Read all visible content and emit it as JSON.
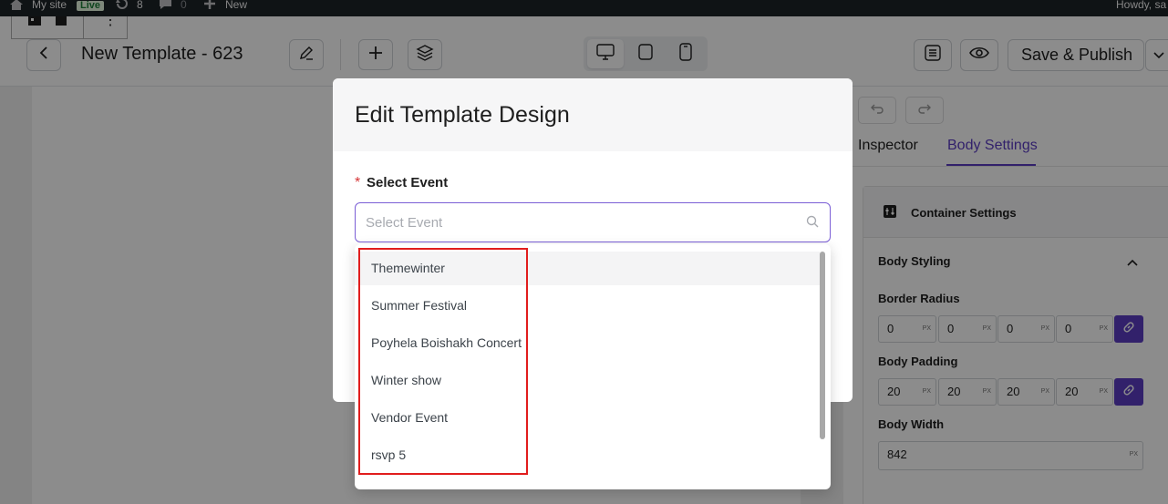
{
  "adminbar": {
    "site_name": "My site",
    "live_badge": "Live",
    "updates_count": "8",
    "comments_count": "0",
    "new_label": "New",
    "greeting": "Howdy, sa"
  },
  "toolbar": {
    "title": "New Template - 623",
    "publish_label": "Save & Publish"
  },
  "panel": {
    "tabs": [
      {
        "label": "Inspector",
        "active": false
      },
      {
        "label": "Body Settings",
        "active": true
      }
    ],
    "section_title": "Container Settings",
    "group_title": "Body Styling",
    "border_radius": {
      "label": "Border Radius",
      "values": [
        "0",
        "0",
        "0",
        "0"
      ],
      "unit": "PX"
    },
    "body_padding": {
      "label": "Body Padding",
      "values": [
        "20",
        "20",
        "20",
        "20"
      ],
      "unit": "PX"
    },
    "body_width": {
      "label": "Body Width",
      "value": "842",
      "unit": "PX"
    }
  },
  "modal": {
    "title": "Edit Template Design",
    "required_mark": "*",
    "field_label": "Select Event",
    "placeholder": "Select Event",
    "options": [
      "Themewinter",
      "Summer Festival",
      "Poyhela Boishakh Concert",
      "Winter show",
      "Vendor Event",
      "rsvp 5"
    ]
  },
  "colors": {
    "accent": "#5b3cc4",
    "required": "#d63638",
    "highlight": "#e11d1d",
    "adminbar": "#1d2327"
  }
}
